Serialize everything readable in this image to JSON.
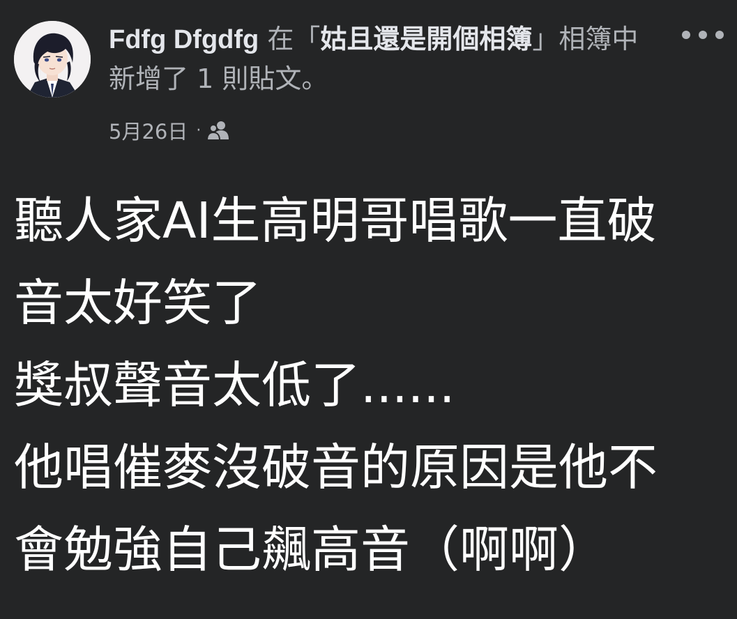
{
  "post": {
    "author": "Fdfg Dfgdfg",
    "action_prefix": " 在「",
    "album_name": "姑且還是開個相簿",
    "action_suffix": "」相簿中新增了 1 則貼文。",
    "date": "5月26日",
    "separator": "·",
    "audience_icon": "friends-icon",
    "more_icon": "more-options-icon",
    "body_lines": [
      "聽人家AI生高明哥唱歌一直破",
      "音太好笑了",
      "獎叔聲音太低了......",
      "他唱催麥沒破音的原因是他不",
      "會勉強自己飆高音（啊啊）"
    ]
  },
  "colors": {
    "background": "#242526",
    "primary_text": "#e4e6eb",
    "secondary_text": "#b0b3b8",
    "body_text": "#ffffff"
  }
}
